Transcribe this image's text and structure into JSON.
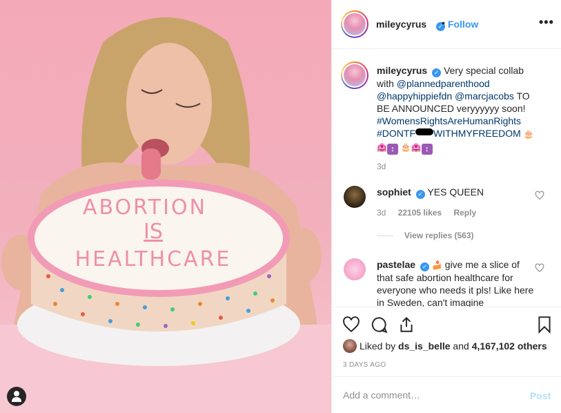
{
  "post": {
    "author": "mileycyrus",
    "follow_label": "Follow",
    "more_label": "•••",
    "dot": "•"
  },
  "photo": {
    "cake_text": [
      "ABORTION",
      "IS",
      "HEALTHCARE"
    ]
  },
  "caption": {
    "username": "mileycyrus",
    "text_1": "Very special collab with ",
    "mention_1": "@plannedparenthood",
    "mention_2": "@happyhippiefdn",
    "mention_3": "@marcjacobs",
    "text_2": " TO BE ANNOUNCED veryyyyyy soon!",
    "hashtag_1": "#WomensRightsAreHumanRights",
    "hashtag_2a": "#DONTF",
    "hashtag_2b": "WITHMYFREEDOM",
    "emoji_cake": "🎂",
    "emoji_house": "🏩",
    "emoji_box": "↕",
    "age": "3d"
  },
  "comments": [
    {
      "username": "sophiet",
      "text": "YES QUEEN",
      "age": "3d",
      "likes": "22105 likes",
      "reply_label": "Reply",
      "view_replies": "View replies (563)"
    },
    {
      "username": "pastelae",
      "emoji": "🍰",
      "text": "give me a slice of that safe abortion healthcare for everyone who needs it pls! Like here in Sweden, can't imagine"
    }
  ],
  "likes": {
    "liked_by_prefix": "Liked by ",
    "liked_by_user": "ds_is_belle",
    "and": " and ",
    "others": "4,167,102 others"
  },
  "posted_ago": "3 DAYS AGO",
  "add_comment": {
    "placeholder": "Add a comment…",
    "post_label": "Post"
  },
  "colors": {
    "link": "#00376b",
    "follow": "#3897f0",
    "muted": "#8e8e8e",
    "post_disabled": "#b2dffc",
    "photo_bg": "#f4a9b8"
  }
}
